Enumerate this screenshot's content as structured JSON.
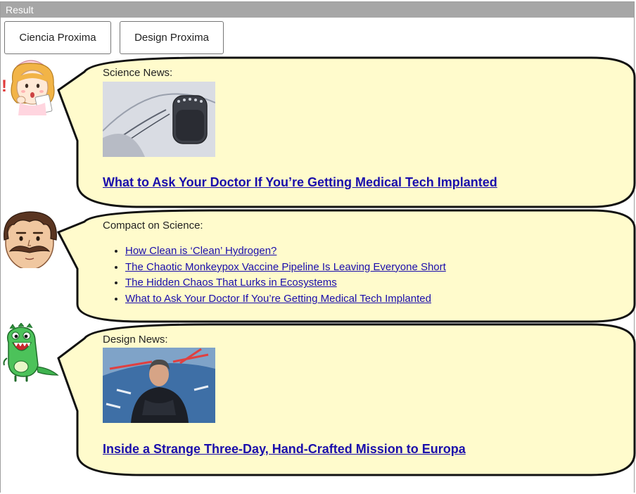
{
  "window": {
    "title": "Result"
  },
  "buttons": [
    {
      "label": "Ciencia Proxima"
    },
    {
      "label": "Design Proxima"
    }
  ],
  "bubbles": {
    "fill": "#fffbcc",
    "stroke": "#111111",
    "science": {
      "label": "Science News:",
      "headline": "What to Ask Your Doctor If You’re Getting Medical Tech Implanted",
      "image_alt": "implanted medical device"
    },
    "compact": {
      "label": "Compact on Science:",
      "items": [
        "How Clean is ‘Clean’ Hydrogen?",
        "The Chaotic Monkeypox Vaccine Pipeline Is Leaving Everyone Short",
        "The Hidden Chaos That Lurks in Ecosystems",
        "What to Ask Your Doctor If You’re Getting Medical Tech Implanted"
      ]
    },
    "design": {
      "label": "Design News:",
      "headline": "Inside a Strange Three-Day, Hand-Crafted Mission to Europa",
      "image_alt": "man crouching on blue floor"
    }
  },
  "avatars": [
    "nurse-avatar",
    "mustache-man-avatar",
    "green-dinosaur-avatar"
  ],
  "colors": {
    "link": "#1a0dab",
    "titlebar": "#a6a6a6",
    "bubble_fill": "#fffbcc"
  }
}
